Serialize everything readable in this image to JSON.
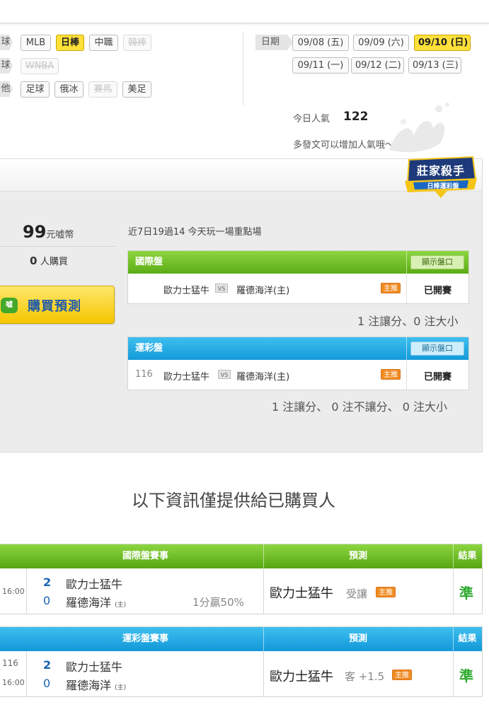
{
  "filters": {
    "row1": {
      "side": "球",
      "chips": [
        {
          "label": "MLB",
          "state": "normal"
        },
        {
          "label": "日棒",
          "state": "active"
        },
        {
          "label": "中職",
          "state": "normal"
        },
        {
          "label": "韓棒",
          "state": "disabled"
        }
      ]
    },
    "row2": {
      "side": "球",
      "chips": [
        {
          "label": "WNBA",
          "state": "disabled"
        }
      ]
    },
    "row3": {
      "side": "他",
      "chips": [
        {
          "label": "足球",
          "state": "normal"
        },
        {
          "label": "俄冰",
          "state": "normal"
        },
        {
          "label": "賽馬",
          "state": "disabled"
        },
        {
          "label": "美足",
          "state": "normal"
        }
      ]
    }
  },
  "dates": {
    "label": "日期",
    "row1": [
      {
        "label": "09/08 (五)",
        "active": false
      },
      {
        "label": "09/09 (六)",
        "active": false
      },
      {
        "label": "09/10 (日)",
        "active": true
      }
    ],
    "row2": [
      {
        "label": "09/11 (一)",
        "active": false
      },
      {
        "label": "09/12 (二)",
        "active": false
      },
      {
        "label": "09/13 (三)",
        "active": false
      }
    ]
  },
  "popularity": {
    "label": "今日人氣",
    "value": "122",
    "tip": "多發文可以增加人氣哦～"
  },
  "badge": {
    "title": "莊家殺手",
    "subtitle": "日棒運彩盤"
  },
  "offer": {
    "price": "99",
    "unit": "元嘘幣",
    "buyers_count": "0",
    "buyers_suffix": "人購買",
    "buy_button": "購買預測",
    "buy_icon_text": "嘘"
  },
  "record": "近7日19過14 今天玩一場重點場",
  "intl_panel": {
    "title": "國際盤",
    "show_button": "顯示盤口",
    "row": {
      "game_no": "",
      "away": "歐力士猛牛",
      "vs": "VS",
      "home": "羅德海洋(主)",
      "tag": "主推",
      "status": "已開賽"
    },
    "summary": "1 注讓分、0 注大小"
  },
  "sports_panel": {
    "title": "運彩盤",
    "show_button": "顯示盤口",
    "row": {
      "game_no": "116",
      "away": "歐力士猛牛",
      "vs": "VS",
      "home": "羅德海洋(主)",
      "tag": "主推",
      "status": "已開賽"
    },
    "summary": "1 注讓分、 0 注不讓分、 0 注大小"
  },
  "notice": "以下資訊僅提供給已購買人",
  "table_intl": {
    "headers": {
      "match": "國際盤賽事",
      "prediction": "預測",
      "result": "結果"
    },
    "row": {
      "game_no": "",
      "time": "16:00",
      "away_score": "2",
      "away_team": "歐力士猛牛",
      "home_score": "0",
      "home_team": "羅德海洋",
      "home_mark": "(主)",
      "spread_note": "1分贏50%",
      "pred_team": "歐力士猛牛",
      "pred_sub": "受讓",
      "tag": "主推",
      "result": "準"
    }
  },
  "table_sports": {
    "headers": {
      "match": "運彩盤賽事",
      "prediction": "預測",
      "result": "結果"
    },
    "row": {
      "game_no": "116",
      "time": "16:00",
      "away_score": "2",
      "away_team": "歐力士猛牛",
      "home_score": "0",
      "home_team": "羅德海洋",
      "home_mark": "(主)",
      "pred_team": "歐力士猛牛",
      "pred_sub": "客 +1.5",
      "tag": "主推",
      "result": "準"
    }
  }
}
